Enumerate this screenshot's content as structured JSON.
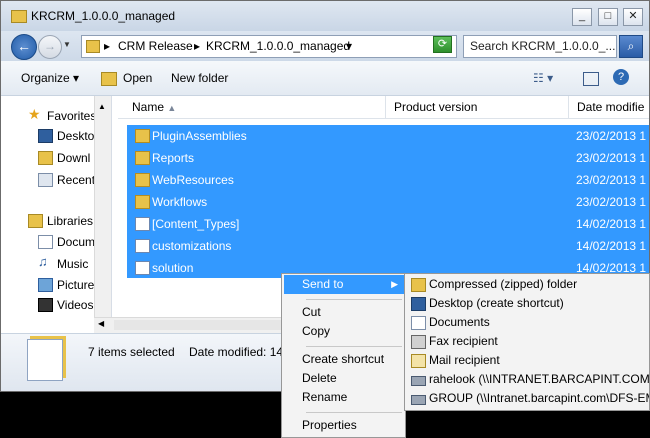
{
  "window": {
    "title": "KRCRM_1.0.0.0_managed"
  },
  "address": {
    "crumbs": [
      "CRM Release",
      "KRCRM_1.0.0.0_managed"
    ],
    "search_placeholder": "Search KRCRM_1.0.0.0_..."
  },
  "toolbar": {
    "organize": "Organize",
    "open": "Open",
    "new_folder": "New folder"
  },
  "nav": {
    "favorites": "Favorites",
    "fav_items": [
      "Deskto",
      "Downl",
      "Recent"
    ],
    "libraries": "Libraries",
    "lib_items": [
      "Docum",
      "Music",
      "Picture",
      "Videos"
    ]
  },
  "columns": {
    "name": "Name",
    "product_version": "Product version",
    "date_modified": "Date modifie"
  },
  "files": [
    {
      "name": "PluginAssemblies",
      "date": "23/02/2013 1",
      "icon": "folder-icon"
    },
    {
      "name": "Reports",
      "date": "23/02/2013 1",
      "icon": "folder-icon"
    },
    {
      "name": "WebResources",
      "date": "23/02/2013 1",
      "icon": "folder-icon"
    },
    {
      "name": "Workflows",
      "date": "23/02/2013 1",
      "icon": "folder-icon"
    },
    {
      "name": "[Content_Types]",
      "date": "14/02/2013 1",
      "icon": "xml-file-icon"
    },
    {
      "name": "customizations",
      "date": "14/02/2013 1",
      "icon": "xml-file-icon"
    },
    {
      "name": "solution",
      "date": "14/02/2013 1",
      "icon": "xml-file-icon"
    }
  ],
  "details": {
    "selected": "7 items selected",
    "date_modified": "Date modified: 14"
  },
  "context_menu": {
    "send_to": "Send to",
    "cut": "Cut",
    "copy": "Copy",
    "create_shortcut": "Create shortcut",
    "delete": "Delete",
    "rename": "Rename",
    "properties": "Properties"
  },
  "send_to_menu": [
    {
      "label": "Compressed (zipped) folder",
      "icon": "zip-folder-icon"
    },
    {
      "label": "Desktop (create shortcut)",
      "icon": "desktop-icon"
    },
    {
      "label": "Documents",
      "icon": "documents-icon"
    },
    {
      "label": "Fax recipient",
      "icon": "fax-icon"
    },
    {
      "label": "Mail recipient",
      "icon": "mail-icon"
    },
    {
      "label": "rahelook (\\\\INTRANET.BARCAPINT.COM\\",
      "icon": "network-drive-icon"
    },
    {
      "label": "GROUP (\\\\Intranet.barcapint.com\\DFS-EM",
      "icon": "network-drive-icon"
    }
  ],
  "colors": {
    "selection": "#3399ff",
    "folder": "#e8c24a"
  }
}
